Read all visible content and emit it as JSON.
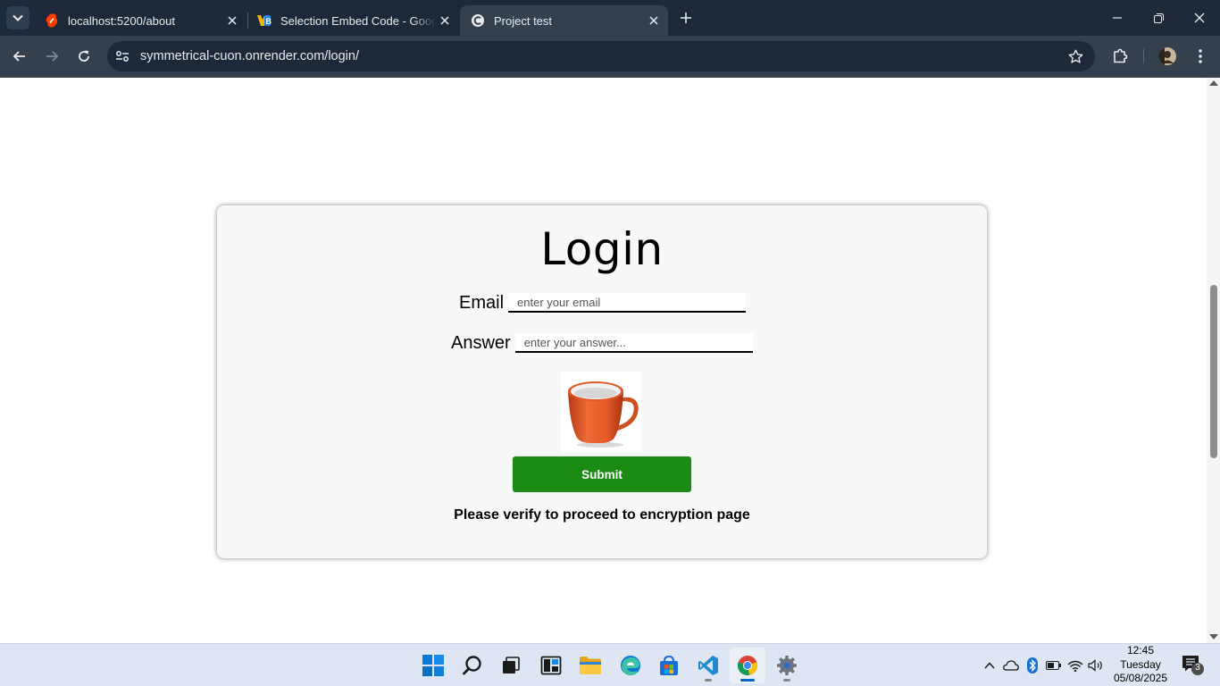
{
  "browser": {
    "tabs": [
      {
        "title": "localhost:5200/about",
        "favicon": "svelte-icon",
        "active": false
      },
      {
        "title": "Selection Embed Code - Google",
        "favicon": "yb-icon",
        "active": false
      },
      {
        "title": "Project test",
        "favicon": "render-icon",
        "active": true
      }
    ],
    "url": "symmetrical-cuon.onrender.com/login/"
  },
  "page": {
    "title": "Login",
    "email": {
      "label": "Email",
      "placeholder": "enter your email",
      "value": ""
    },
    "answer": {
      "label": "Answer",
      "placeholder": "enter your answer...",
      "value": ""
    },
    "captcha_image": "orange-cup",
    "submit_label": "Submit",
    "message": "Please verify to proceed to encryption page",
    "colors": {
      "submit": "#1a8c13",
      "card": "#f8f8f8"
    }
  },
  "taskbar": {
    "apps": [
      "windows-start",
      "search",
      "task-view",
      "widgets",
      "file-explorer",
      "edge",
      "microsoft-store",
      "vs-code",
      "chrome",
      "settings"
    ],
    "clock": {
      "time": "12:45",
      "day": "Tuesday",
      "date": "05/08/2025"
    },
    "notifications": "3"
  }
}
